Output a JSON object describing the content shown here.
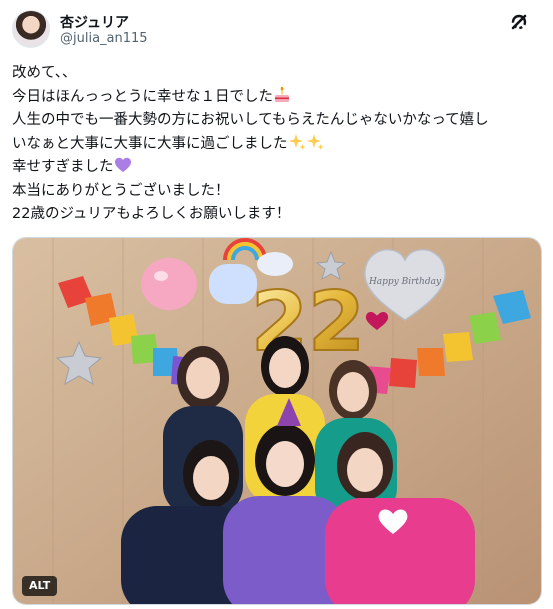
{
  "user": {
    "display_name": "杏ジュリア",
    "handle": "@julia_an115"
  },
  "tweet": {
    "lines": [
      "改めて、、",
      "今日はほんっっとうに幸せな１日でした",
      "人生の中でも一番大勢の方にお祝いしてもらえたんじゃないかなって嬉し",
      "いなぁと大事に大事に大事に過ごしました",
      "幸せすぎました",
      "本当にありがとうございました！",
      "22歳のジュリアもよろしくお願いします！"
    ]
  },
  "photo": {
    "alt_label": "ALT",
    "balloon_numbers": "22",
    "heart_balloon_text": "Happy Birthday"
  },
  "icons": {
    "logo": "x-logo-icon",
    "cake": "birthday-cake-icon",
    "sparkles": "sparkles-icon",
    "heart": "purple-heart-icon"
  },
  "colors": {
    "text": "#0f1419",
    "secondary": "#536471",
    "heart": "#ab7ee6",
    "sparkle": "#ffcc4d"
  }
}
